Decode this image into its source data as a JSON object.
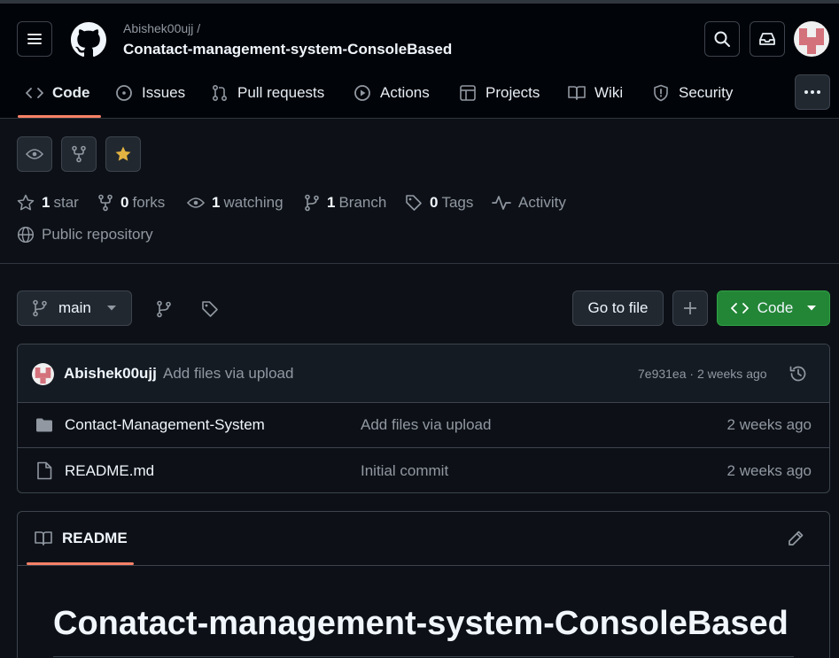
{
  "header": {
    "owner": "Abishek00ujj /",
    "repo_name": "Conatact-management-system-ConsoleBased"
  },
  "nav": {
    "tabs": [
      {
        "label": "Code",
        "icon": "code-icon",
        "active": true
      },
      {
        "label": "Issues",
        "icon": "issue-icon"
      },
      {
        "label": "Pull requests",
        "icon": "pull-request-icon"
      },
      {
        "label": "Actions",
        "icon": "play-icon"
      },
      {
        "label": "Projects",
        "icon": "table-icon"
      },
      {
        "label": "Wiki",
        "icon": "book-icon"
      },
      {
        "label": "Security",
        "icon": "shield-icon"
      }
    ]
  },
  "stats": {
    "star_count": "1",
    "star_label": "star",
    "fork_count": "0",
    "fork_label": "forks",
    "watch_count": "1",
    "watch_label": "watching",
    "branch_count": "1",
    "branch_label": "Branch",
    "tag_count": "0",
    "tag_label": "Tags",
    "activity_label": "Activity",
    "visibility": "Public repository"
  },
  "toolbar": {
    "branch": "main",
    "go_to_file": "Go to file",
    "code_button": "Code"
  },
  "latest_commit": {
    "author": "Abishek00ujj",
    "message": "Add files via upload",
    "hash_age": "7e931ea · 2 weeks ago"
  },
  "files": [
    {
      "name": "Contact-Management-System",
      "type": "folder",
      "message": "Add files via upload",
      "age": "2 weeks ago"
    },
    {
      "name": "README.md",
      "type": "file",
      "message": "Initial commit",
      "age": "2 weeks ago"
    }
  ],
  "readme": {
    "tab_label": "README",
    "title": "Conatact-management-system-ConsoleBased"
  },
  "colors": {
    "background": "#0d1117",
    "header_bg": "#010409",
    "accent_underline": "#f78166",
    "code_button_green": "#238636",
    "star_yellow": "#e3b341"
  }
}
